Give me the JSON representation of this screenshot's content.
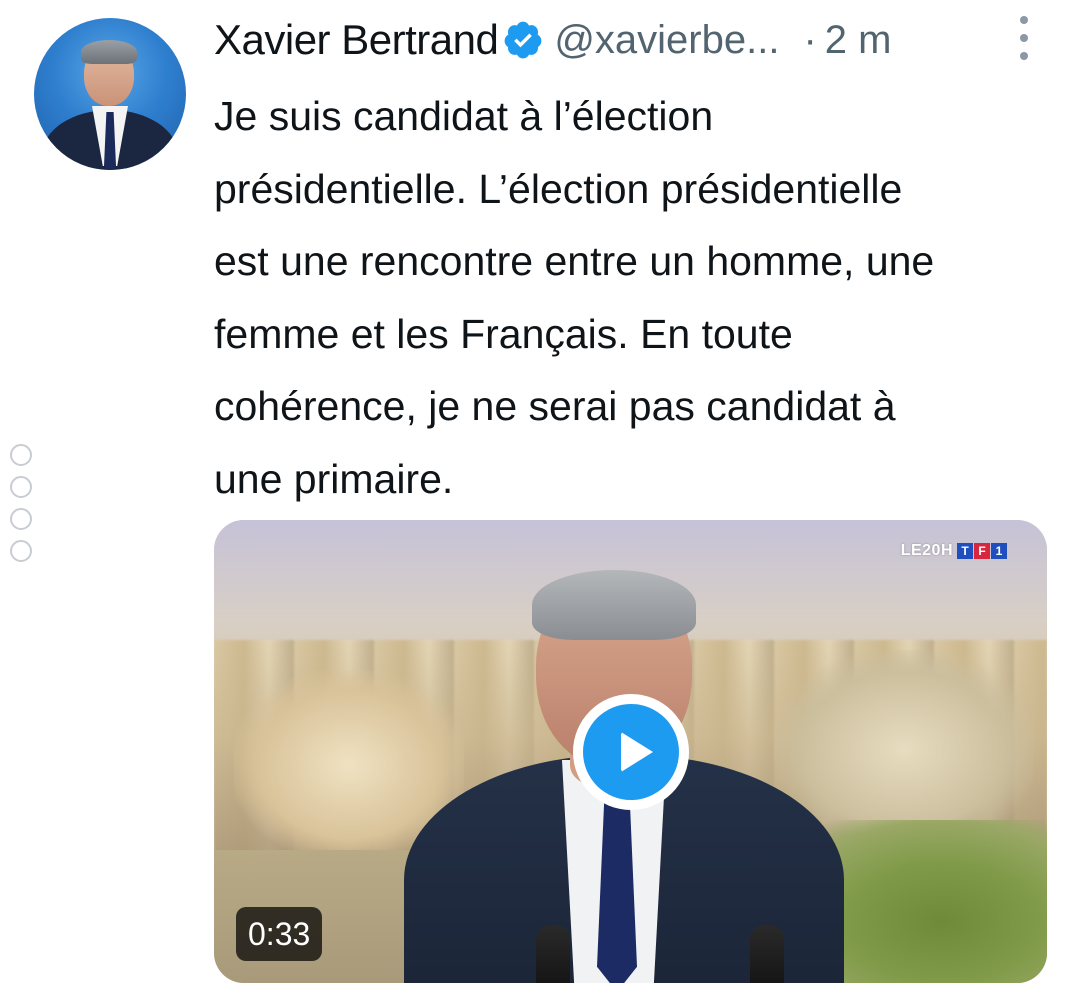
{
  "author": {
    "name": "Xavier Bertrand",
    "handle": "@xavierbe...",
    "separator": "·",
    "time": "2 m",
    "verified": true,
    "verified_color": "#1d9bf0"
  },
  "tweet": {
    "lines": [
      "Je suis candidat à l’élection",
      "présidentielle. L’élection présidentielle",
      "est une rencontre entre un homme, une",
      "femme et les Français. En toute",
      "cohérence, je ne serai pas candidat à",
      "une primaire."
    ]
  },
  "media": {
    "type": "video",
    "duration": "0:33",
    "broadcast_logo": {
      "show": "LE20H",
      "channel_letters": [
        "T",
        "F",
        "1"
      ]
    },
    "play_button_color": "#1d9bf0"
  },
  "icons": {
    "more": "more-vertical-icon",
    "verified": "verified-badge-icon",
    "play": "play-icon"
  }
}
